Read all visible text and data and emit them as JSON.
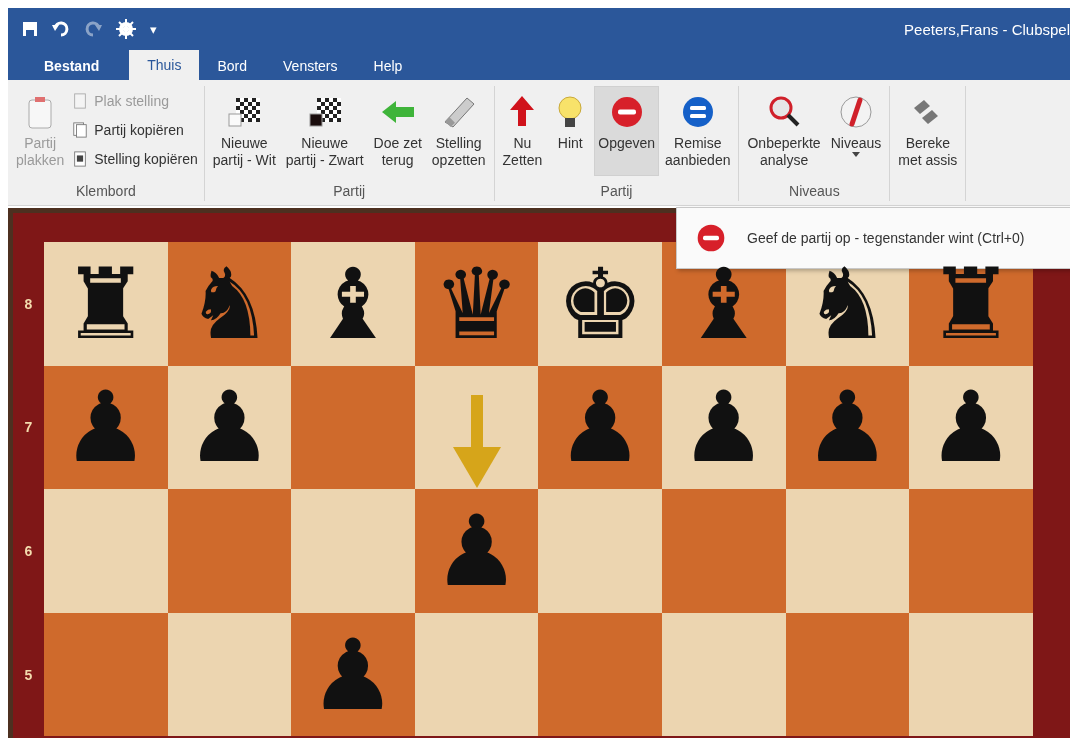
{
  "quick_access": {
    "redo_disabled": true,
    "customize": "▾"
  },
  "window": {
    "title": "Peeters,Frans - Clubspel"
  },
  "tabs": [
    {
      "label": "Bestand",
      "kind": "file",
      "selected": false
    },
    {
      "label": "Thuis",
      "kind": "tab",
      "selected": true
    },
    {
      "label": "Bord",
      "kind": "tab",
      "selected": false
    },
    {
      "label": "Vensters",
      "kind": "tab",
      "selected": false
    },
    {
      "label": "Help",
      "kind": "tab",
      "selected": false
    }
  ],
  "ribbon": {
    "groups": [
      {
        "label": "Klembord",
        "items": [
          {
            "kind": "large",
            "lines": [
              "Partij",
              "plakken"
            ],
            "disabled": true
          },
          {
            "kind": "small",
            "lines": [
              "Plak stelling"
            ],
            "disabled": true
          },
          {
            "kind": "small",
            "lines": [
              "Partij kopiëren"
            ],
            "disabled": false
          },
          {
            "kind": "small",
            "lines": [
              "Stelling kopiëren"
            ],
            "disabled": false
          }
        ]
      },
      {
        "label": "Partij",
        "items": [
          {
            "kind": "large",
            "lines": [
              "Nieuwe",
              "partij - Wit"
            ],
            "disabled": false
          },
          {
            "kind": "large",
            "lines": [
              "Nieuwe",
              "partij - Zwart"
            ],
            "disabled": false
          },
          {
            "kind": "large",
            "lines": [
              "Doe zet",
              "terug"
            ],
            "disabled": false
          },
          {
            "kind": "large",
            "lines": [
              "Stelling",
              "opzetten"
            ],
            "disabled": false
          }
        ]
      },
      {
        "label": "Partij",
        "items": [
          {
            "kind": "large",
            "lines": [
              "Nu",
              "Zetten"
            ],
            "disabled": false
          },
          {
            "kind": "large",
            "lines": [
              "Hint"
            ],
            "disabled": false
          },
          {
            "kind": "large",
            "lines": [
              "Opgeven"
            ],
            "disabled": false,
            "hovered": true
          },
          {
            "kind": "large",
            "lines": [
              "Remise",
              "aanbieden"
            ],
            "disabled": false
          }
        ]
      },
      {
        "label": "Niveaus",
        "items": [
          {
            "kind": "large",
            "lines": [
              "Onbeperkte",
              "analyse"
            ],
            "disabled": false
          },
          {
            "kind": "dropdown",
            "lines": [
              "Niveaus"
            ],
            "disabled": false
          }
        ]
      },
      {
        "items": [
          {
            "kind": "large",
            "lines": [
              "Bereke",
              "met assis"
            ],
            "disabled": false
          }
        ]
      }
    ]
  },
  "tooltip": {
    "text": "Geef de partij op - tegenstander wint (Ctrl+0)"
  },
  "board": {
    "ranks": [
      {
        "label": "8",
        "squares": [
          {
            "light": true,
            "piece": "♜"
          },
          {
            "light": false,
            "piece": "♞"
          },
          {
            "light": true,
            "piece": "♝"
          },
          {
            "light": false,
            "piece": "♛"
          },
          {
            "light": true,
            "piece": "♚"
          },
          {
            "light": false,
            "piece": "♝"
          },
          {
            "light": true,
            "piece": "♞"
          },
          {
            "light": false,
            "piece": "♜"
          }
        ]
      },
      {
        "label": "7",
        "squares": [
          {
            "light": false,
            "piece": "♟"
          },
          {
            "light": true,
            "piece": "♟"
          },
          {
            "light": false
          },
          {
            "light": true
          },
          {
            "light": false,
            "piece": "♟"
          },
          {
            "light": true,
            "piece": "♟"
          },
          {
            "light": false,
            "piece": "♟"
          },
          {
            "light": true,
            "piece": "♟"
          }
        ]
      },
      {
        "label": "6",
        "squares": [
          {
            "light": true
          },
          {
            "light": false
          },
          {
            "light": true
          },
          {
            "light": false,
            "piece": "♟",
            "arrow": true
          },
          {
            "light": true
          },
          {
            "light": false
          },
          {
            "light": true
          },
          {
            "light": false
          }
        ]
      },
      {
        "label": "5",
        "squares": [
          {
            "light": false
          },
          {
            "light": true
          },
          {
            "light": false,
            "piece": "♟"
          },
          {
            "light": true
          },
          {
            "light": false
          },
          {
            "light": true
          },
          {
            "light": false
          },
          {
            "light": true
          }
        ]
      }
    ]
  }
}
